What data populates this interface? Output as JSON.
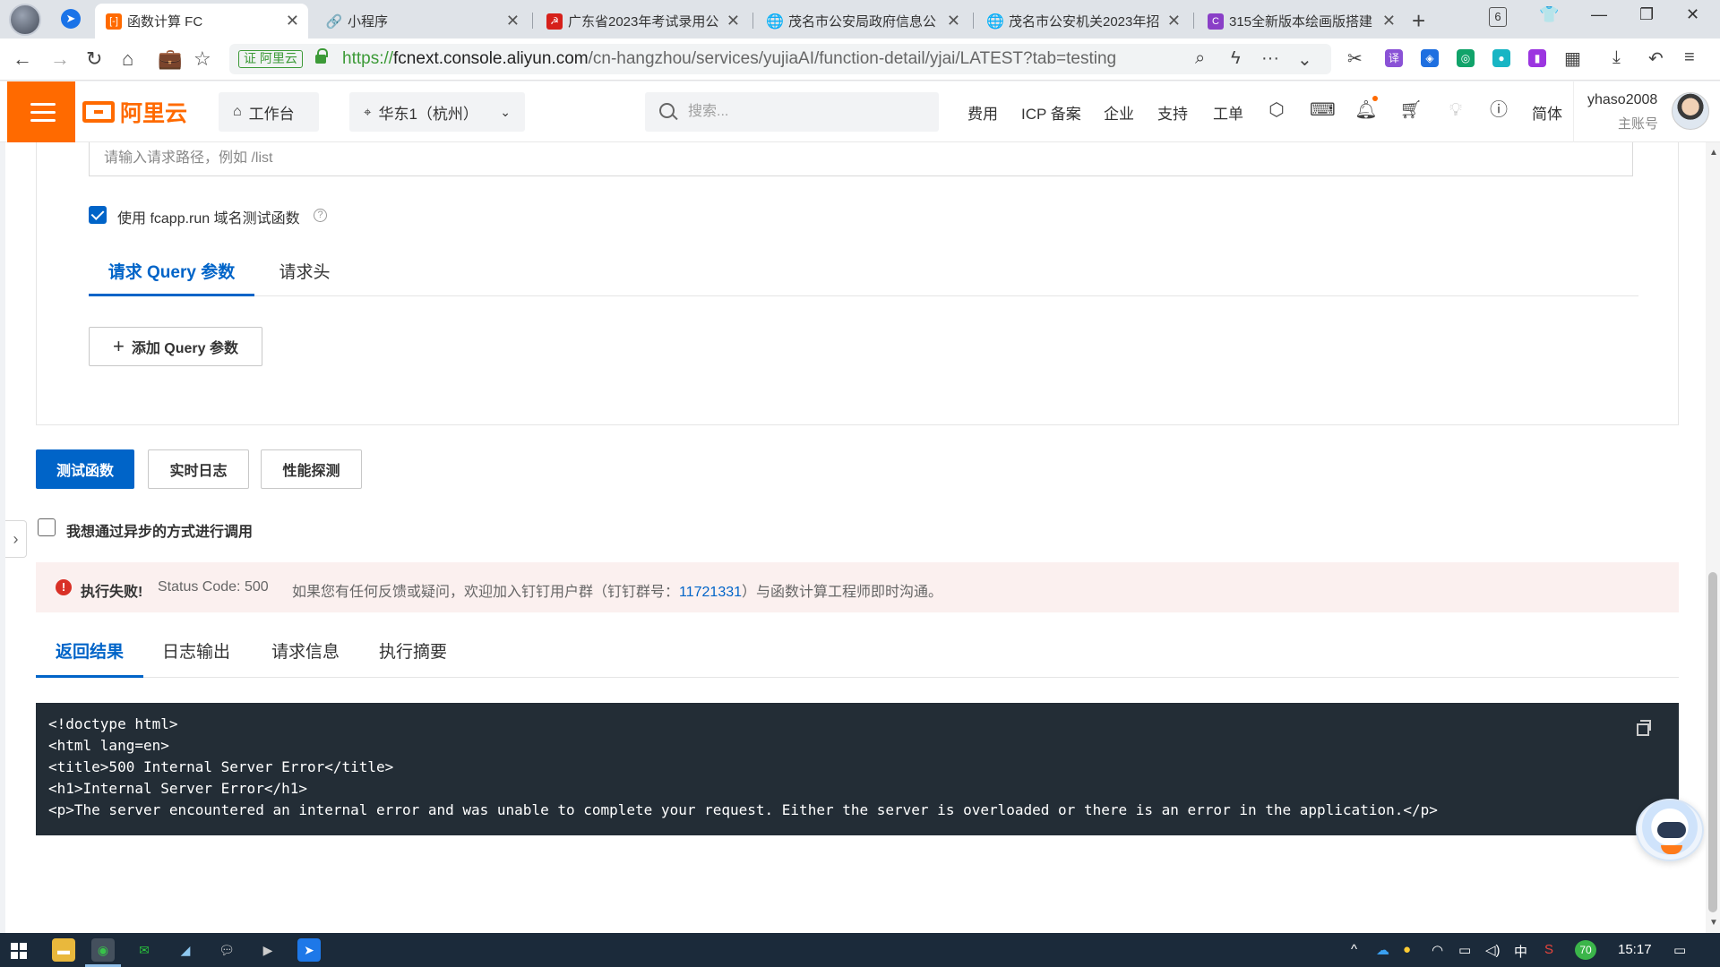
{
  "browser": {
    "tabs": [
      {
        "title": "函数计算 FC",
        "favicon": "aliyun-orange",
        "active": true
      },
      {
        "title": "小程序",
        "favicon": "link-blue",
        "active": false
      },
      {
        "title": "广东省2023年考试录用公",
        "favicon": "party-red",
        "active": false
      },
      {
        "title": "茂名市公安局政府信息公",
        "favicon": "globe",
        "active": false
      },
      {
        "title": "茂名市公安机关2023年招",
        "favicon": "globe",
        "active": false
      },
      {
        "title": "315全新版本绘画版搭建",
        "favicon": "c-purple",
        "active": false
      }
    ],
    "tab_count": "6",
    "address": {
      "cert_label": "证 阿里云",
      "scheme": "https://",
      "host": "fcnext.console.aliyun.com",
      "path": "/cn-hangzhou/services/yujiaAI/function-detail/yjai/LATEST?tab=testing"
    }
  },
  "console_header": {
    "logo_text": "阿里云",
    "workbench_label": "工作台",
    "region_label": "华东1（杭州）",
    "search_placeholder": "搜索...",
    "links": [
      "费用",
      "ICP 备案",
      "企业",
      "支持",
      "工单"
    ],
    "lang_label": "简体",
    "user_name": "yhaso2008",
    "user_role": "主账号",
    "brand_color": "#ff6a00"
  },
  "request": {
    "path_placeholder": "请输入请求路径，例如 /list",
    "use_domain_label": "使用 fcapp.run 域名测试函数",
    "use_domain_checked": true,
    "tabs": [
      "请求 Query 参数",
      "请求头"
    ],
    "active_tab": 0,
    "add_query_label": "添加 Query 参数"
  },
  "actions": {
    "test_label": "测试函数",
    "log_label": "实时日志",
    "perf_label": "性能探测",
    "async_label": "我想通过异步的方式进行调用",
    "async_checked": false
  },
  "alert": {
    "title": "执行失败!",
    "status": "Status Code: 500",
    "message_before": "如果您有任何反馈或疑问，欢迎加入钉钉用户群（钉钉群号：",
    "group_number": "11721331",
    "message_after": "）与函数计算工程师即时沟通。",
    "color": "#d93026"
  },
  "result": {
    "tabs": [
      "返回结果",
      "日志输出",
      "请求信息",
      "执行摘要"
    ],
    "active_tab": 0,
    "lines": [
      "<!doctype html>",
      "<html lang=en>",
      "<title>500 Internal Server Error</title>",
      "<h1>Internal Server Error</h1>",
      "<p>The server encountered an internal error and was unable to complete your request. Either the server is overloaded or there is an error in the application.</p>"
    ]
  },
  "taskbar": {
    "time": "15:17",
    "ime": "中",
    "badge": "70",
    "accent": "#0064c8"
  }
}
